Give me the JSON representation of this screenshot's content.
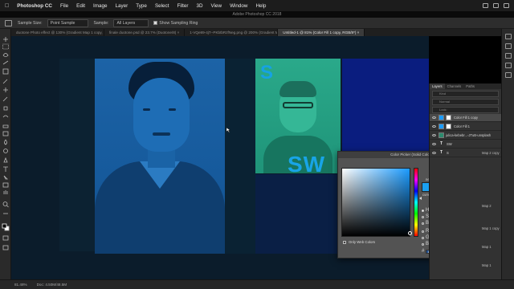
{
  "menubar": {
    "app_name": "Photoshop CC",
    "items": [
      "File",
      "Edit",
      "Image",
      "Layer",
      "Type",
      "Select",
      "Filter",
      "3D",
      "View",
      "Window",
      "Help"
    ]
  },
  "window_title": "Adobe Photoshop CC 2018",
  "options_bar": {
    "sample_size_label": "Sample Size:",
    "sample_size_value": "Point Sample",
    "sample_label": "Sample:",
    "sample_value": "All Layers",
    "show_ring_label": "Show Sampling Ring"
  },
  "tabs": [
    {
      "label": "duotone Photo effect @ 130% (Gradient Map 1 copy, RGB/8#) ×",
      "active": false
    },
    {
      "label": "finale duotone.psd @ 23.7% (Duotone/8) ×",
      "active": false
    },
    {
      "label": "1-VQe89-4jT--PKbtbRzfNeg.png @ 200% (Gradient Map 1, Layer Mask/8) ×",
      "active": false
    },
    {
      "label": "Untitled-1 @ 81% (Color Fill 1 copy, RGB/8*) ×",
      "active": true
    }
  ],
  "canvas": {
    "card_text_s": "S",
    "card_text_sw": "SW"
  },
  "color_picker": {
    "title": "Color Picker (Solid Color)",
    "new_label": "new",
    "current_label": "current",
    "ok_label": "OK",
    "cancel_label": "Cancel",
    "add_swatches_label": "Add to Swatches",
    "color_libraries_label": "Color Libraries",
    "only_web_colors_label": "Only Web Colors",
    "new_color": "#1ba0f0",
    "fields": {
      "H": "199",
      "H_unit": "°",
      "S": "89",
      "S_unit": "%",
      "B": "94",
      "B_unit": "%",
      "R": "27",
      "G": "160",
      "Bv": "240",
      "L": "62",
      "a": "-6",
      "b": "-48",
      "C": "71",
      "C_unit": "%",
      "M": "25",
      "M_unit": "%",
      "Y": "0",
      "Y_unit": "%",
      "K": "0",
      "K_unit": "%",
      "hex": "1ba0f0"
    }
  },
  "layers_panel": {
    "tabs": [
      "Layers",
      "Channels",
      "Paths"
    ],
    "kind_label": "Kind",
    "normal_label": "Normal",
    "lock_label": "Lock:",
    "items": [
      {
        "name": "Color Fill 1 copy",
        "type": "fill",
        "selected": true
      },
      {
        "name": "Color Fill 1",
        "type": "fill",
        "selected": false
      },
      {
        "name": "julica-kebebr...-JTuB-unsplash",
        "type": "image",
        "selected": false
      },
      {
        "name": "SW",
        "type": "text",
        "selected": false
      },
      {
        "name": "S",
        "type": "text",
        "selected": false
      }
    ]
  },
  "side_items": [
    "Map 2 copy",
    "Map 2",
    "Map 1 copy",
    "Map 1",
    "Map 1"
  ],
  "statusbar": {
    "zoom": "81.48%",
    "doc": "Doc: 4.50M/48.5M"
  }
}
